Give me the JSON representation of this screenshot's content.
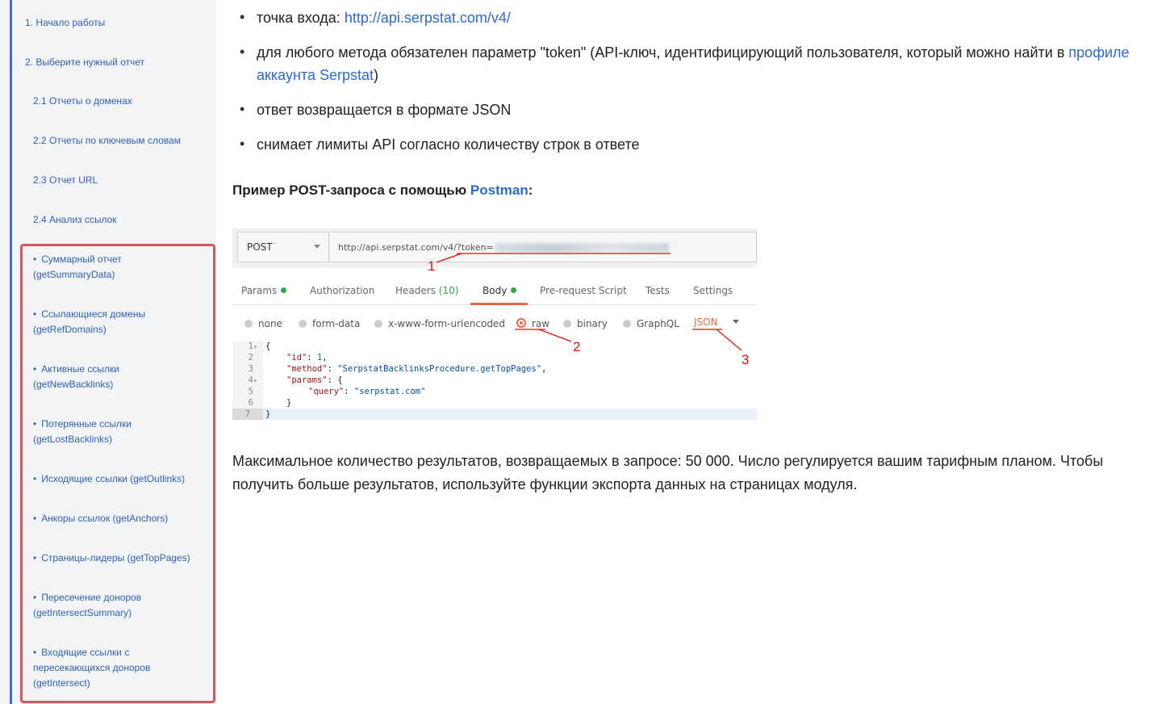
{
  "sidebar": {
    "items": [
      {
        "label": "1. Начало работы"
      },
      {
        "label": "2. Выберите нужный отчет"
      },
      {
        "label": "2.1 Отчеты о доменах"
      },
      {
        "label": "2.2 Отчеты по ключевым словам"
      },
      {
        "label": "2.3 Отчет URL"
      },
      {
        "label": "2.4 Анализ ссылок"
      }
    ],
    "subitems": [
      {
        "line1": "Суммарный отчет",
        "line2": "(getSummaryData)"
      },
      {
        "line1": "Ссылающиеся домены",
        "line2": "(getRefDomains)"
      },
      {
        "line1": "Активные ссылки",
        "line2": "(getNewBacklinks)"
      },
      {
        "line1": "Потерянные ссылки",
        "line2": "(getLostBacklinks)"
      },
      {
        "line1": "Исходящие ссылки (getOutlinks)"
      },
      {
        "line1": "Анкоры ссылок (getAnchors)"
      },
      {
        "line1": "Страницы-лидеры (getTopPages)"
      },
      {
        "line1": "Пересечение доноров",
        "line2": "(getIntersectSummary)"
      },
      {
        "line1": "Входящие ссылки с",
        "line2": "пересекающихся доноров",
        "line3": "(getIntersect)"
      }
    ],
    "bullet": "•"
  },
  "content": {
    "bullets": [
      {
        "pre": "точка входа: ",
        "link": "http://api.serpstat.com/v4/"
      },
      {
        "pre": "для любого метода обязателен параметр \"token\" (API-ключ, идентифицирующий пользователя, который можно найти в ",
        "link": "профиле аккаунта Serpstat",
        "post": ")"
      },
      {
        "pre": "ответ возвращается в формате JSON"
      },
      {
        "pre": "снимает лимиты API согласно количеству строк в ответе"
      }
    ],
    "bullet_char": "•",
    "example_heading": {
      "pre": "Пример POST-запроса с помощью ",
      "link": "Postman",
      "post": ":"
    },
    "paragraph": "Максимальное количество результатов, возвращаемых в запросе: 50 000. Число регулируется вашим тарифным планом. Чтобы получить больше результатов, используйте функции экспорта данных на страницах модуля."
  },
  "postman": {
    "method": "POST",
    "url": "http://api.serpstat.com/v4/?token=",
    "tabs": [
      {
        "label": "Params",
        "dot": true
      },
      {
        "label": "Authorization"
      },
      {
        "label": "Headers",
        "count": "(10)"
      },
      {
        "label": "Body",
        "dot": true,
        "active": true
      },
      {
        "label": "Pre-request Script"
      },
      {
        "label": "Tests"
      },
      {
        "label": "Settings"
      }
    ],
    "body_modes": [
      "none",
      "form-data",
      "x-www-form-urlencoded",
      "raw",
      "binary",
      "GraphQL"
    ],
    "selected_mode": "raw",
    "format": "JSON",
    "code_lines": [
      {
        "n": "1",
        "fold": true,
        "text": "{"
      },
      {
        "n": "2",
        "key": "\"id\"",
        "rest": ": ",
        "num": "1",
        "tail": ","
      },
      {
        "n": "3",
        "key": "\"method\"",
        "rest": ": ",
        "str": "\"SerpstatBacklinksProcedure.getTopPages\"",
        "tail": ","
      },
      {
        "n": "4",
        "fold": true,
        "key": "\"params\"",
        "rest": ": {"
      },
      {
        "n": "5",
        "key": "\"query\"",
        "rest": ": ",
        "str": "\"serpstat.com\""
      },
      {
        "n": "6",
        "text": "}"
      },
      {
        "n": "7",
        "text": "}"
      }
    ],
    "annotations": [
      "1",
      "2",
      "3"
    ],
    "colors": {
      "accent": "#e8683f",
      "green": "#2ea44f",
      "annotation": "#dd1111"
    }
  }
}
